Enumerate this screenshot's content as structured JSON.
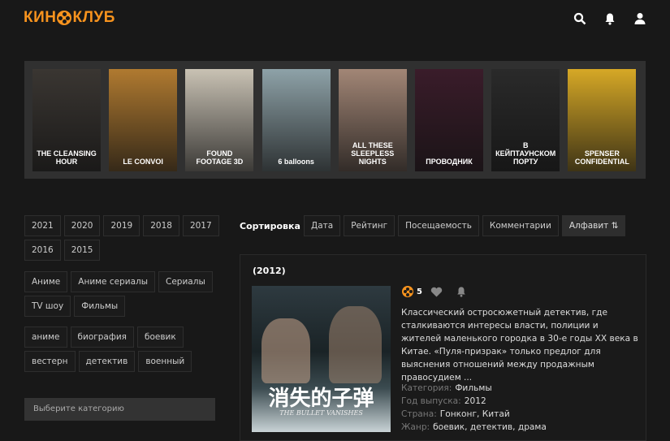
{
  "header": {
    "logo_left": "КИН",
    "logo_right": "КЛУБ",
    "icons": [
      "search-icon",
      "bell-icon",
      "user-icon"
    ]
  },
  "carousel": {
    "posters": [
      {
        "title": "THE CLEANSING HOUR",
        "color": "#3a3632"
      },
      {
        "title": "LE CONVOI",
        "color": "#b07a30"
      },
      {
        "title": "FOUND FOOTAGE 3D",
        "color": "#c9c2b4"
      },
      {
        "title": "6 balloons",
        "color": "#8ea2a8"
      },
      {
        "title": "ALL THESE SLEEPLESS NIGHTS",
        "color": "#a28676"
      },
      {
        "title": "ПРОВОДНИК",
        "color": "#3a1c2a"
      },
      {
        "title": "В КЕЙПТАУНСКОМ ПОРТУ",
        "color": "#2a2a2a"
      },
      {
        "title": "SPENSER CONFIDENTIAL",
        "color": "#d6a826"
      }
    ]
  },
  "filters": {
    "years": [
      "2021",
      "2020",
      "2019",
      "2018",
      "2017",
      "2016",
      "2015"
    ],
    "categories": [
      "Аниме",
      "Аниме сериалы",
      "Сериалы",
      "TV шоу",
      "Фильмы"
    ],
    "genres": [
      "аниме",
      "биография",
      "боевик",
      "вестерн",
      "детектив",
      "военный"
    ],
    "select_placeholder": "Выберите категорию"
  },
  "sort": {
    "label": "Сортировка",
    "options": [
      "Дата",
      "Рейтинг",
      "Посещаемость",
      "Комментарии",
      "Алфавит ⇅"
    ],
    "active": 4
  },
  "movie": {
    "year": "(2012)",
    "rating": "5",
    "description": "Классический остросюжетный детектив, где сталкиваются интересы власти, полиции и жителей маленького городка в 30-е годы XX века в Китае. «Пуля-призрак» только предлог для выяснения отношений между продажным правосудием ...",
    "meta": [
      {
        "label": "Категория:",
        "value": "Фильмы"
      },
      {
        "label": "Год выпуска:",
        "value": "2012"
      },
      {
        "label": "Страна:",
        "value": "Гонконг, Китай"
      },
      {
        "label": "Жанр:",
        "value": "боевик, детектив, драма"
      }
    ],
    "poster_title": "消失的子弹",
    "poster_subtitle": "THE BULLET VANISHES"
  },
  "colors": {
    "accent": "#f7931e",
    "bg": "#181818"
  }
}
